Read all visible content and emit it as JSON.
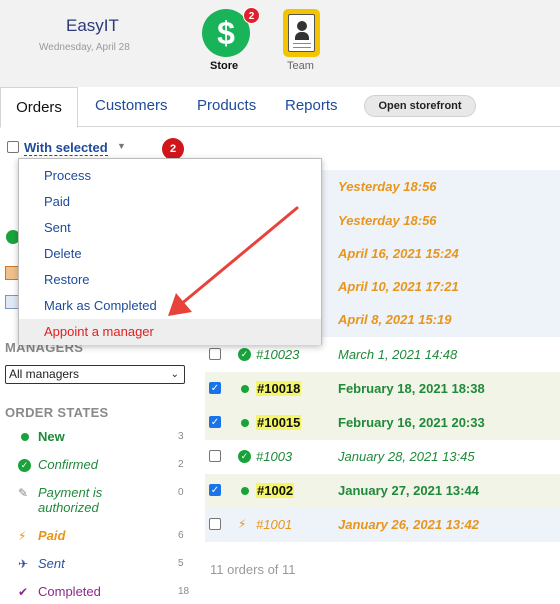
{
  "app": {
    "title": "EasyIT",
    "date": "Wednesday, April 28"
  },
  "apps": {
    "store": {
      "label": "Store",
      "badge": "2",
      "icon": "dollar-sign-icon",
      "color": "#19b35a"
    },
    "team": {
      "label": "Team",
      "icon": "id-badge-icon",
      "color": "#f5c400"
    }
  },
  "tabs": [
    {
      "label": "Orders",
      "active": true
    },
    {
      "label": "Customers"
    },
    {
      "label": "Products"
    },
    {
      "label": "Reports"
    }
  ],
  "storefront_button": "Open storefront",
  "toolbar": {
    "with_selected": "With selected",
    "selected_count": "2"
  },
  "actions_menu": [
    {
      "label": "Process"
    },
    {
      "label": "Paid"
    },
    {
      "label": "Sent"
    },
    {
      "label": "Delete"
    },
    {
      "label": "Restore"
    },
    {
      "label": "Mark as Completed"
    },
    {
      "label": "Appoint a manager",
      "active": true
    }
  ],
  "orders": [
    {
      "number": "",
      "date": "Yesterday 18:56",
      "checked": false
    },
    {
      "number": "",
      "date": "Yesterday 18:56",
      "checked": false
    },
    {
      "number": "",
      "date": "April 16, 2021 15:24",
      "checked": false
    },
    {
      "number": "",
      "date": "April 10, 2021 17:21",
      "checked": false
    },
    {
      "number": "",
      "date": "April 8, 2021 15:19",
      "checked": false
    },
    {
      "number": "#10023",
      "date": "March 1, 2021 14:48",
      "checked": false,
      "state": "Confirmed"
    },
    {
      "number": "#10018",
      "date": "February 18, 2021 18:38",
      "checked": true,
      "state": "New"
    },
    {
      "number": "#10015",
      "date": "February 16, 2021 20:33",
      "checked": true,
      "state": "New"
    },
    {
      "number": "#1003",
      "date": "January 28, 2021 13:45",
      "checked": false,
      "state": "Confirmed"
    },
    {
      "number": "#1002",
      "date": "January 27, 2021 13:44",
      "checked": true,
      "state": "New"
    },
    {
      "number": "#1001",
      "date": "January 26, 2021 13:42",
      "checked": false,
      "state": "Paid"
    }
  ],
  "orders_count": "11 orders of 11",
  "managers": {
    "title": "MANAGERS",
    "selected": "All managers"
  },
  "order_states": {
    "title": "ORDER STATES",
    "items": [
      {
        "label": "New",
        "count": "3",
        "icon": "dot-icon",
        "color": "#1aa33b"
      },
      {
        "label": "Confirmed",
        "count": "2",
        "icon": "check-circle-icon",
        "color": "#1aa33b"
      },
      {
        "label": "Payment is authorized",
        "count": "0",
        "icon": "pen-icon",
        "color": "#888888"
      },
      {
        "label": "Paid",
        "count": "6",
        "icon": "lightning-icon",
        "color": "#e8951c"
      },
      {
        "label": "Sent",
        "count": "5",
        "icon": "paper-plane-icon",
        "color": "#2b4fa0"
      },
      {
        "label": "Completed",
        "count": "18",
        "icon": "check-mark-icon",
        "color": "#8e2a8a"
      }
    ]
  }
}
